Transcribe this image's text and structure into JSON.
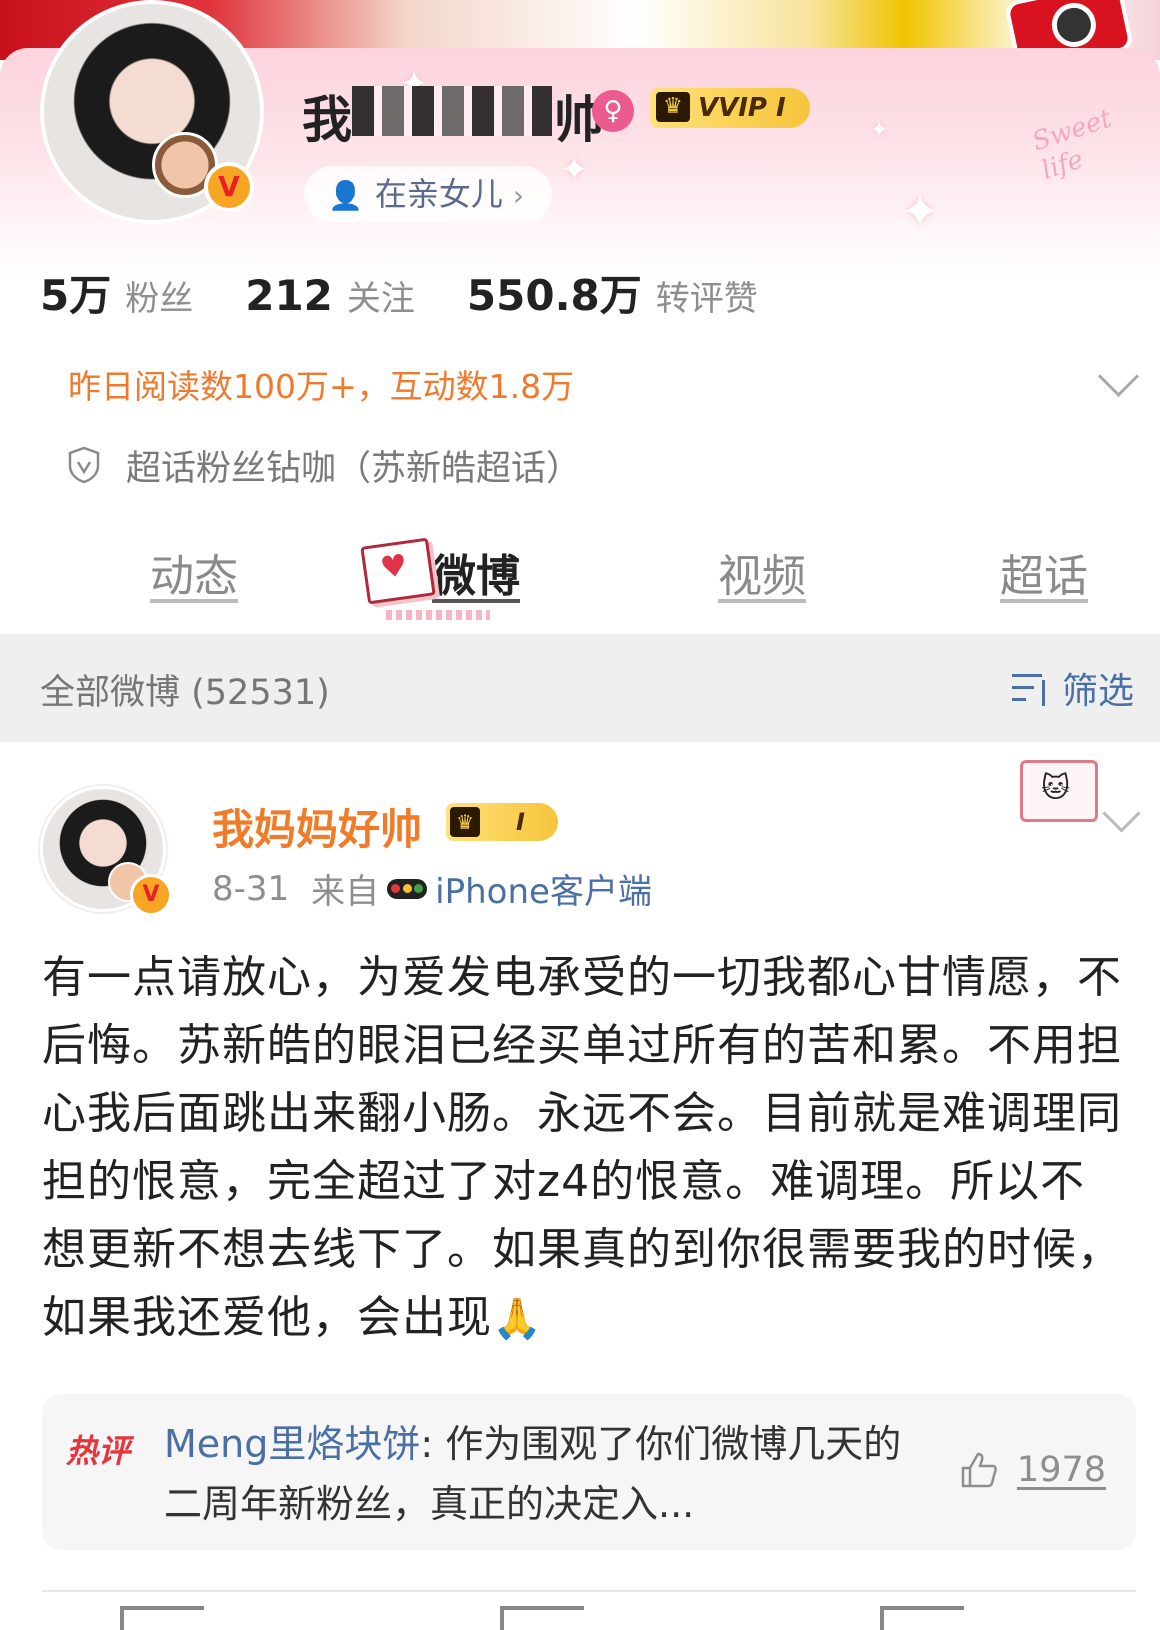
{
  "profile": {
    "name_visible_prefix": "我",
    "name_visible_suffix": "帅",
    "vip_label": "VVIP I",
    "relation": "在亲女儿",
    "stats": [
      {
        "value": "5万",
        "label": "粉丝"
      },
      {
        "value": "212",
        "label": "关注"
      },
      {
        "value": "550.8万",
        "label": "转评赞"
      }
    ],
    "reads_summary": "昨日阅读数100万+，互动数1.8万",
    "supertopic": "超话粉丝钻咖（苏新皓超话）",
    "deco_text": "Sweet life"
  },
  "tabs": [
    {
      "label": "动态",
      "active": false
    },
    {
      "label": "微博",
      "active": true
    },
    {
      "label": "视频",
      "active": false
    },
    {
      "label": "超话",
      "active": false
    }
  ],
  "filter_bar": {
    "all_posts": "全部微博 (52531)",
    "filter_label": "筛选"
  },
  "post": {
    "author": "我妈妈好帅",
    "level": "I",
    "date": "8-31",
    "from_label": "来自",
    "client": "iPhone客户端",
    "body": "有一点请放心，为爱发电承受的一切我都心甘情愿，不后悔。苏新皓的眼泪已经买单过所有的苦和累。不用担心我后面跳出来翻小肠。永远不会。目前就是难调理同担的恨意，完全超过了对z4的恨意。难调理。所以不想更新不想去线下了。如果真的到你很需要我的时候，如果我还爱他，会出现",
    "hot_comment": {
      "tag": "热评",
      "user": "Meng里烙块饼",
      "text": ": 作为围观了你们微博几天的二周年新粉丝，真正的决定入...",
      "likes": "1978"
    }
  },
  "colors": {
    "accent_orange": "#f07c2a",
    "link_blue": "#4a6fa5",
    "hot_red": "#e8333a"
  }
}
